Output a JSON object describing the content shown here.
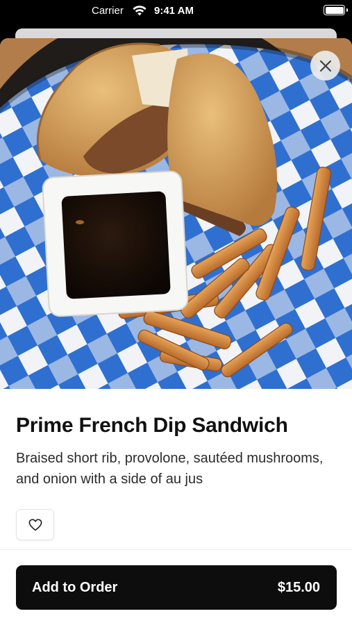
{
  "status_bar": {
    "carrier": "Carrier",
    "time": "9:41 AM",
    "wifi_icon": "wifi-icon",
    "battery_icon": "battery-icon"
  },
  "item": {
    "image_alt": "Prime French Dip Sandwich with fries and au jus",
    "title": "Prime French Dip Sandwich",
    "description": "Braised short rib, provolone, sautéed mushrooms, and onion with a side of au jus"
  },
  "actions": {
    "close_icon": "close-icon",
    "favorite_icon": "heart-icon",
    "add_to_order_label": "Add to Order",
    "price": "$15.00"
  },
  "colors": {
    "button_bg": "#0d0d0d",
    "accent_blue": "#2f6fd0"
  }
}
